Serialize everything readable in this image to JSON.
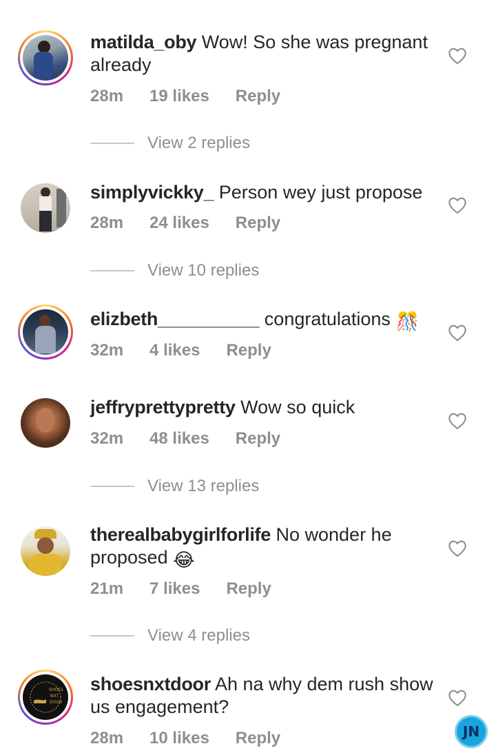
{
  "comments": [
    {
      "username": "matilda_oby",
      "text": "Wow! So she was pregnant already",
      "time": "28m",
      "likes": "19 likes",
      "reply": "Reply",
      "view_replies": "View 2 replies",
      "avatar_ring": true
    },
    {
      "username": "simplyvickky_",
      "text": "Person wey just propose",
      "time": "28m",
      "likes": "24 likes",
      "reply": "Reply",
      "view_replies": "View 10 replies",
      "avatar_ring": false
    },
    {
      "username": "elizbeth__________",
      "text": "congratulations",
      "emoji": "🎊",
      "time": "32m",
      "likes": "4 likes",
      "reply": "Reply",
      "avatar_ring": true
    },
    {
      "username": "jeffryprettypretty",
      "text": "Wow so quick",
      "time": "32m",
      "likes": "48 likes",
      "reply": "Reply",
      "view_replies": "View 13 replies",
      "avatar_ring": false
    },
    {
      "username": "therealbabygirlforlife",
      "text": "No wonder he proposed",
      "emoji": "😂",
      "time": "21m",
      "likes": "7 likes",
      "reply": "Reply",
      "view_replies": "View 4 replies",
      "avatar_ring": false
    },
    {
      "username": "shoesnxtdoor",
      "text": "Ah na why dem rush show us engagement?",
      "time": "28m",
      "likes": "10 likes",
      "reply": "Reply",
      "avatar_ring": true,
      "avatar_logo_text": "SHOES NXT DOOR"
    }
  ],
  "watermark": {
    "text": "JN"
  },
  "colors": {
    "text": "#262626",
    "meta": "#8e8e8e",
    "divider": "#c7c7c7",
    "heart": "#8e8e8e",
    "watermark": "#1aa3dd"
  }
}
